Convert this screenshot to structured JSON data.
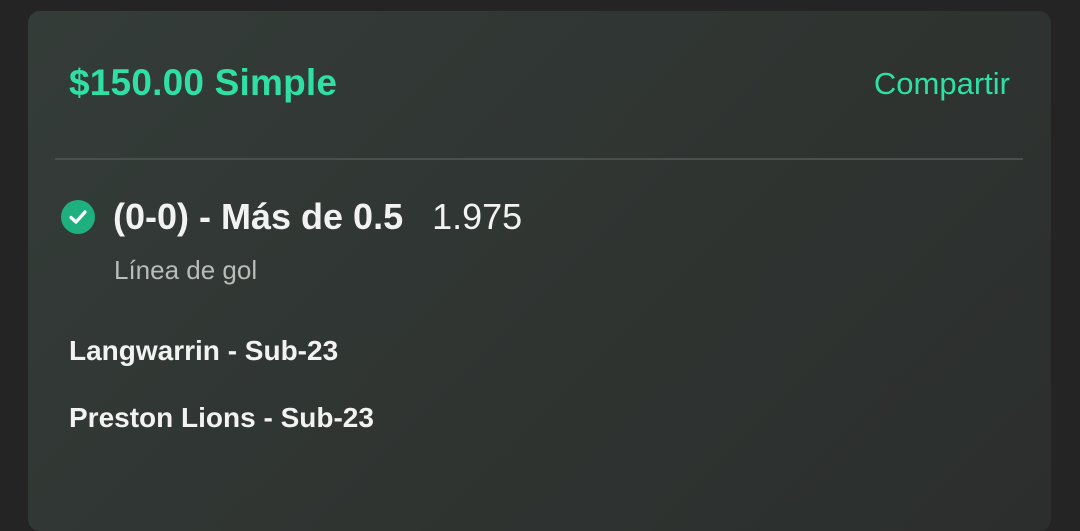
{
  "bet": {
    "stake_title": "$150.00 Simple",
    "share_label": "Compartir",
    "status_icon": "check-circle-icon",
    "colors": {
      "accent": "#2fe0a4",
      "won_badge": "#1fb07f"
    }
  },
  "selection": {
    "name": "(0-0) - Más de 0.5",
    "odds": "1.975",
    "market": "Línea de gol"
  },
  "event": {
    "home_team": "Langwarrin - Sub-23",
    "away_team": "Preston Lions - Sub-23"
  }
}
